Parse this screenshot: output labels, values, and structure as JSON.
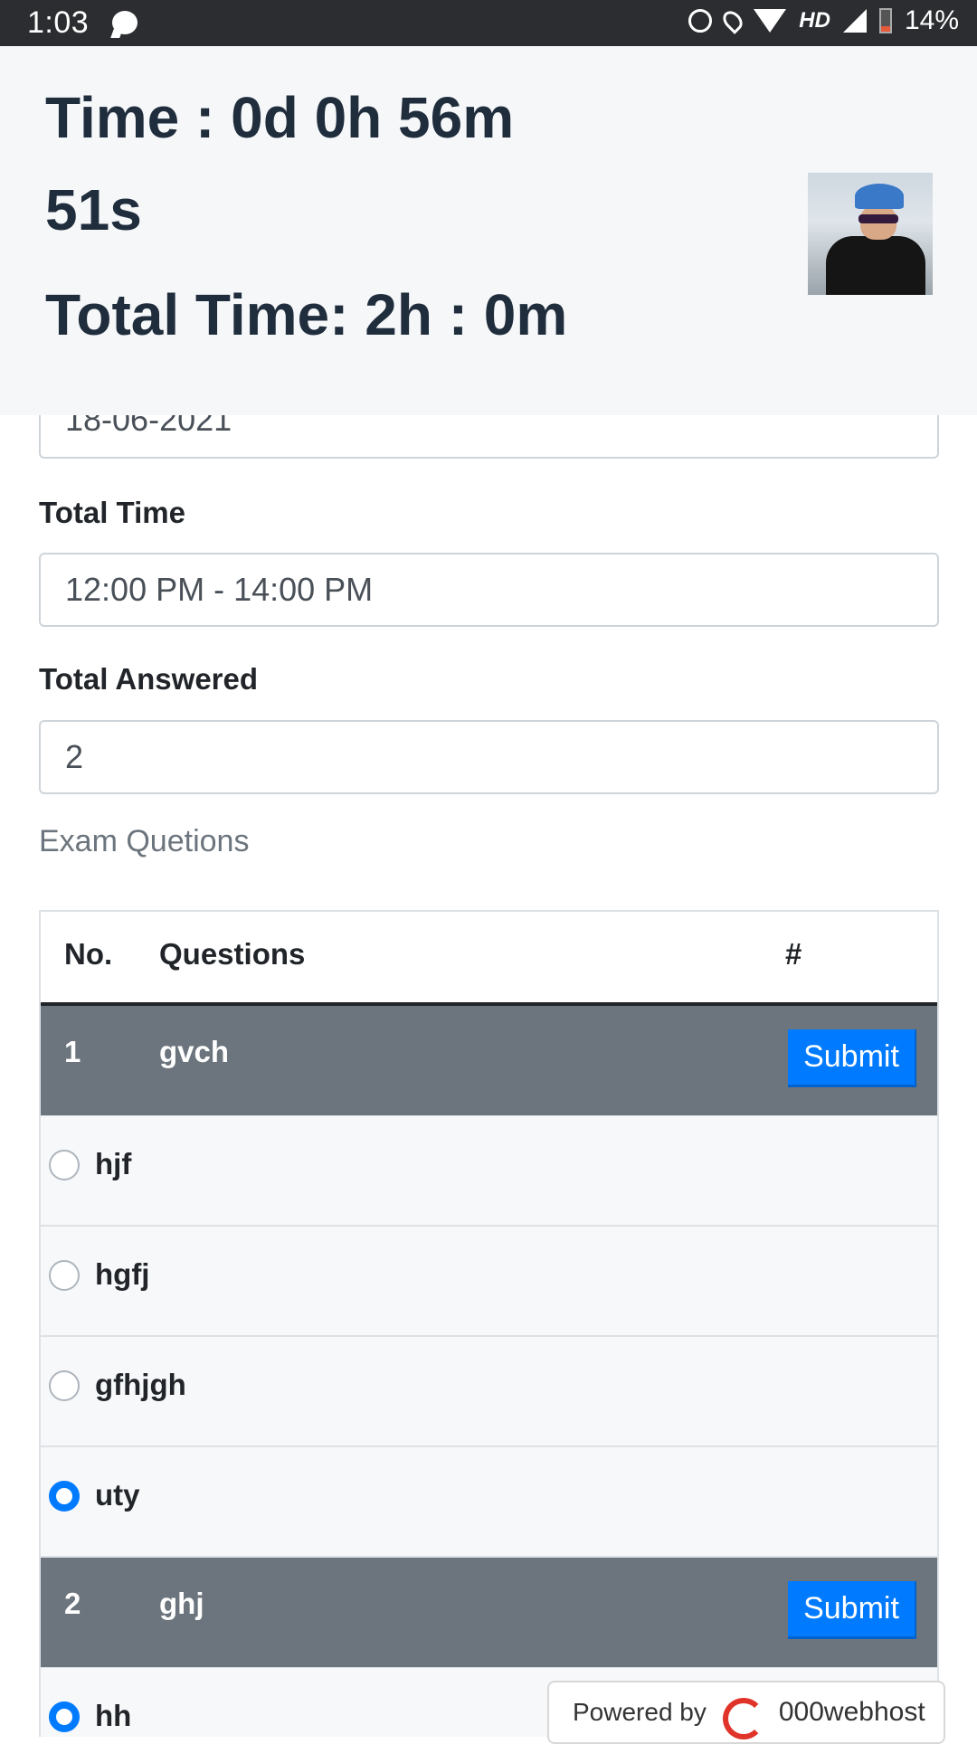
{
  "status_bar": {
    "time": "1:03",
    "network": "HD",
    "battery": "14%"
  },
  "header": {
    "timer": "Time : 0d 0h 56m 51s",
    "total_time": "Total Time: 2h : 0m"
  },
  "form": {
    "date_value": "18-06-2021",
    "total_time_label": "Total Time",
    "total_time_value": "12:00 PM - 14:00 PM",
    "total_answered_label": "Total Answered",
    "total_answered_value": "2",
    "section_title": "Exam Quetions"
  },
  "table": {
    "headers": {
      "no": "No.",
      "questions": "Questions",
      "action": "#"
    },
    "questions": [
      {
        "no": "1",
        "text": "gvch",
        "submit_label": "Submit",
        "options": [
          {
            "label": "hjf",
            "selected": false
          },
          {
            "label": "hgfj",
            "selected": false
          },
          {
            "label": "gfhjgh",
            "selected": false
          },
          {
            "label": "uty",
            "selected": true
          }
        ]
      },
      {
        "no": "2",
        "text": "ghj",
        "submit_label": "Submit",
        "options": [
          {
            "label": "hh",
            "selected": true
          }
        ]
      }
    ]
  },
  "footer": {
    "powered_by": "Powered by",
    "brand": "000webhost"
  },
  "colors": {
    "primary": "#007bff",
    "question_row": "#6c757d",
    "header_text": "#1f2d3d"
  }
}
